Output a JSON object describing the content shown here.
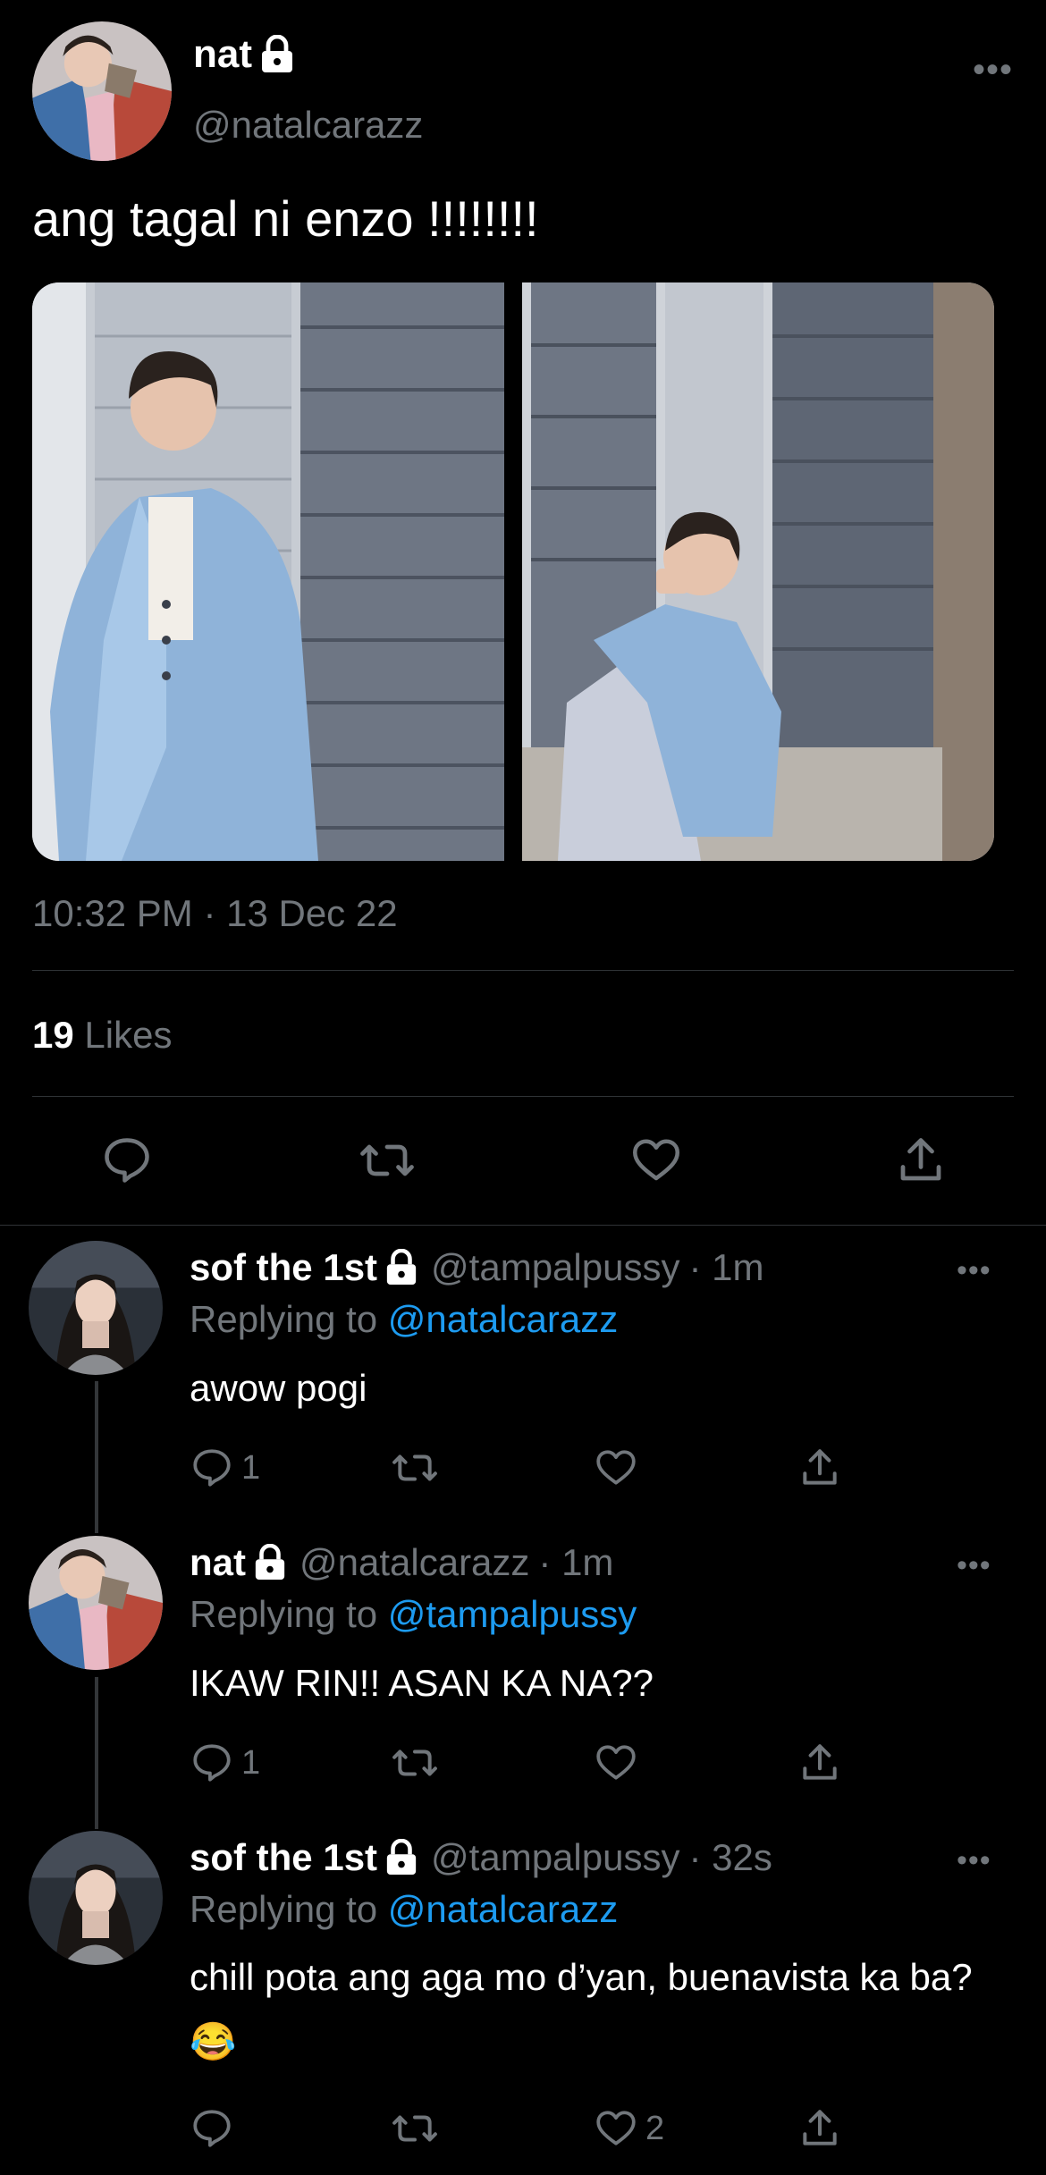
{
  "main_tweet": {
    "name": "nat",
    "handle": "@natalcarazz",
    "text": "ang tagal ni enzo !!!!!!!!",
    "timestamp": "10:32 PM · 13 Dec 22",
    "likes_count": "19",
    "likes_label": "Likes",
    "more_label": "•••"
  },
  "replies": [
    {
      "name": "sof the 1st",
      "handle": "@tampalpussy",
      "time": "· 1m",
      "replying_prefix": "Replying to",
      "replying_to": "@natalcarazz",
      "text": "awow pogi",
      "reply_count": "1",
      "like_count": ""
    },
    {
      "name": "nat",
      "handle": "@natalcarazz",
      "time": "· 1m",
      "replying_prefix": "Replying to",
      "replying_to": "@tampalpussy",
      "text": "IKAW RIN!! ASAN KA NA??",
      "reply_count": "1",
      "like_count": ""
    },
    {
      "name": "sof the 1st",
      "handle": "@tampalpussy",
      "time": "· 32s",
      "replying_prefix": "Replying to",
      "replying_to": "@natalcarazz",
      "text": "chill pota ang aga mo d’yan, buenavista ka ba? 😂",
      "reply_count": "",
      "like_count": "2"
    }
  ],
  "colors": {
    "background": "#000000",
    "text": "#ffffff",
    "secondary": "#71767b",
    "mention": "#1d9bf0",
    "divider": "#2f3336"
  }
}
